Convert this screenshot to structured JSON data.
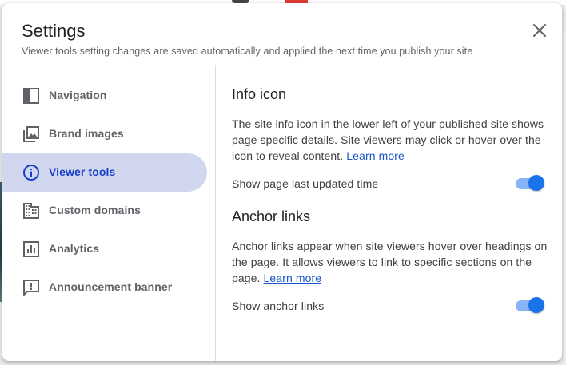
{
  "dialog": {
    "title": "Settings",
    "subtitle": "Viewer tools setting changes are saved automatically and applied the next time you publish your site",
    "close_icon": "close-icon"
  },
  "sidebar": {
    "items": [
      {
        "label": "Navigation",
        "icon": "navigation-panel-icon",
        "active": false
      },
      {
        "label": "Brand images",
        "icon": "image-library-icon",
        "active": false
      },
      {
        "label": "Viewer tools",
        "icon": "info-icon",
        "active": true
      },
      {
        "label": "Custom domains",
        "icon": "domain-building-icon",
        "active": false
      },
      {
        "label": "Analytics",
        "icon": "analytics-chart-icon",
        "active": false
      },
      {
        "label": "Announcement banner",
        "icon": "announcement-icon",
        "active": false
      }
    ]
  },
  "content": {
    "info_icon": {
      "title": "Info icon",
      "description": "The site info icon in the lower left of your published site shows page specific details. Site viewers may click or hover over the icon to reveal content.",
      "learn_more": "Learn more",
      "setting_label": "Show page last updated time",
      "enabled": true
    },
    "anchor_links": {
      "title": "Anchor links",
      "description": "Anchor links appear when site viewers hover over headings on the page. It allows viewers to link to specific sections on the page.",
      "learn_more": "Learn more",
      "setting_label": "Show anchor links",
      "enabled": true
    }
  },
  "colors": {
    "active_nav_bg": "#d2d7f0",
    "active_nav_text": "#1a40c8",
    "toggle_on": "#1a73e8",
    "toggle_track": "#8ab4f8",
    "link": "#1a56c8"
  }
}
